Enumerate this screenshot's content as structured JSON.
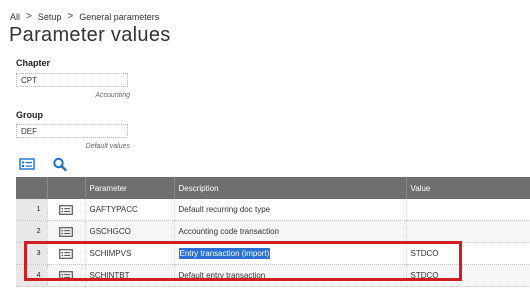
{
  "breadcrumb": {
    "items": [
      "All",
      "Setup",
      "General parameters"
    ],
    "separator": ">"
  },
  "page": {
    "title": "Parameter values"
  },
  "fields": {
    "chapter": {
      "label": "Chapter",
      "value": "CPT",
      "description": "Accounting"
    },
    "group": {
      "label": "Group",
      "value": "DEF",
      "description": "Default values"
    }
  },
  "toolbar": {
    "icons": [
      "list-view-icon",
      "search-icon"
    ]
  },
  "grid": {
    "columns": {
      "parameter": "Parameter",
      "description": "Description",
      "value": "Value"
    },
    "rows": [
      {
        "num": "1",
        "parameter": "GAFTYPACC",
        "description": "Default recurring doc type",
        "value": ""
      },
      {
        "num": "2",
        "parameter": "GSCHGCO",
        "description": "Accounting code transaction",
        "value": ""
      },
      {
        "num": "3",
        "parameter": "SCHIMPVS",
        "description": "Entry transaction (import)",
        "value": "STDCO"
      },
      {
        "num": "4",
        "parameter": "SCHINTBT",
        "description": "Default entry transaction",
        "value": "STDCO"
      }
    ]
  },
  "colors": {
    "header_bg": "#6f6f6f",
    "selection": "#2a6fd6",
    "annotation_frame": "#d11c24",
    "toolbar_icon": "#1a6fd0"
  }
}
